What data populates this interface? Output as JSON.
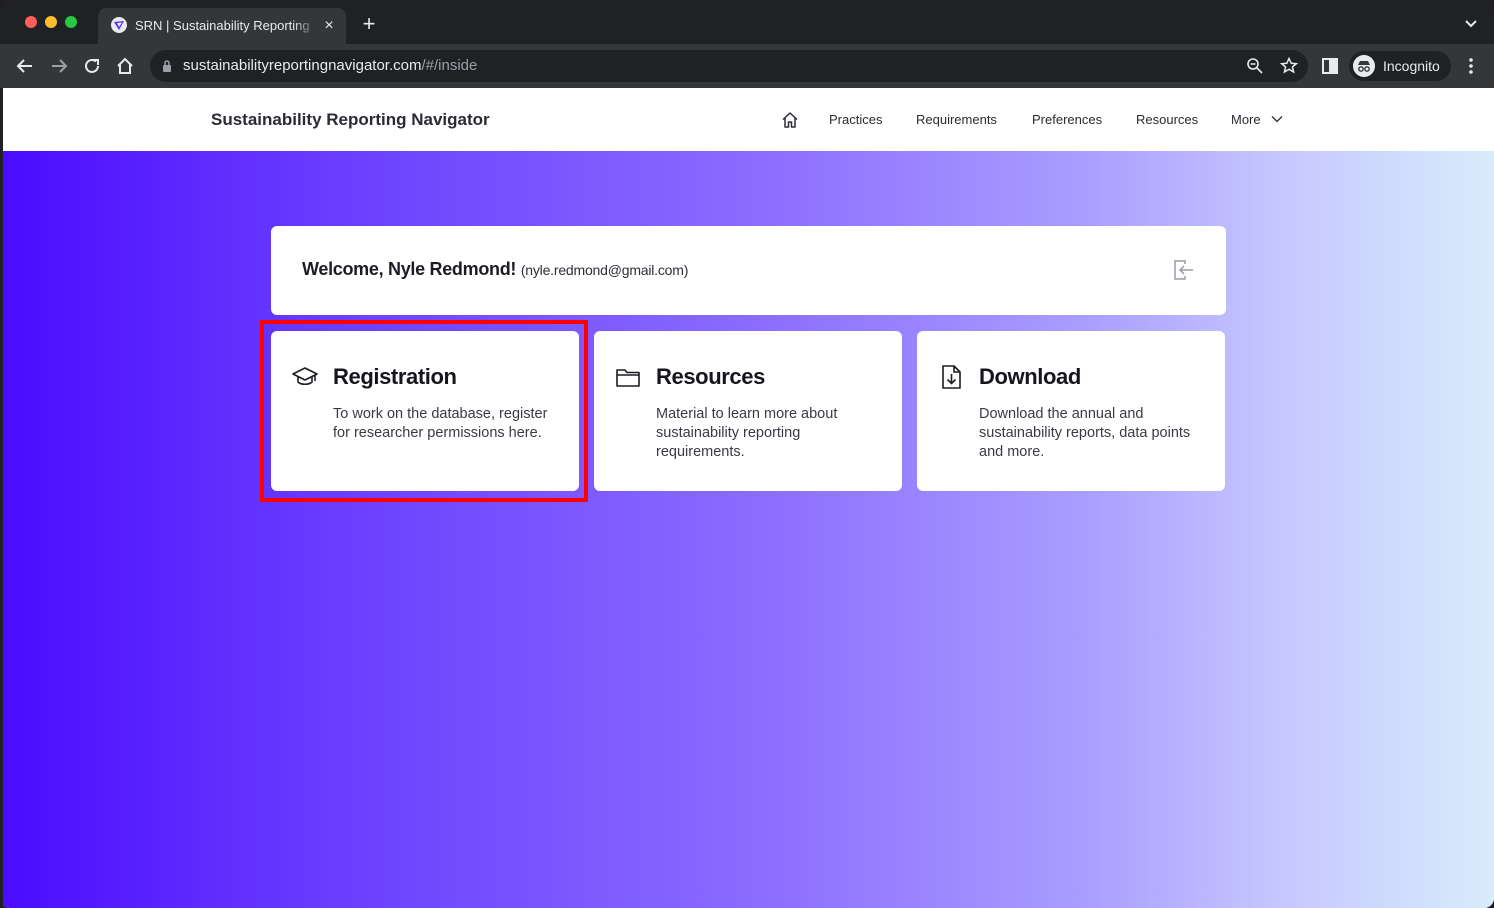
{
  "browser": {
    "tab": {
      "title": "SRN | Sustainability Reporting Navigator",
      "close_glyph": "×"
    },
    "new_tab_glyph": "+",
    "address": {
      "domain": "sustainabilityreportingnavigator.com",
      "path": "/#/inside"
    },
    "profile_label": "Incognito",
    "icons": [
      "back-arrow-icon",
      "forward-arrow-icon",
      "reload-icon",
      "home-icon",
      "lock-icon",
      "zoom-icon",
      "star-icon",
      "sidepanel-icon",
      "incognito-icon",
      "menu-kebab-icon"
    ]
  },
  "site": {
    "brand": "Sustainability Reporting Navigator",
    "nav": {
      "practices": "Practices",
      "requirements": "Requirements",
      "preferences": "Preferences",
      "resources": "Resources",
      "more": "More"
    }
  },
  "welcome": {
    "greeting": "Welcome, Nyle Redmond!",
    "email": "(nyle.redmond@gmail.com)"
  },
  "cards": [
    {
      "title": "Registration",
      "description": "To work on the database, register for researcher permissions here.",
      "icon": "graduation-cap-icon"
    },
    {
      "title": "Resources",
      "description": "Material to learn more about sustainability reporting requirements.",
      "icon": "folder-icon"
    },
    {
      "title": "Download",
      "description": "Download the annual and sustainability reports, data points and more.",
      "icon": "file-download-icon"
    }
  ],
  "colors": {
    "highlight": "#ff0000",
    "gradient_start": "#4a0cff",
    "gradient_end": "#d8ecfb"
  }
}
